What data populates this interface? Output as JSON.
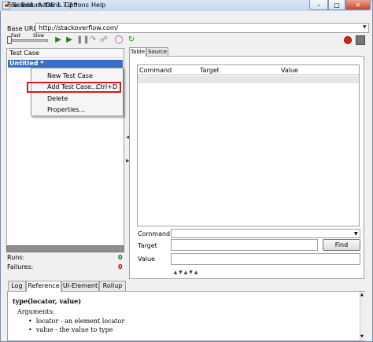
{
  "window": {
    "title": "Selenium IDE 1.7.2 *"
  },
  "menu": [
    "File",
    "Edit",
    "Actions",
    "Options",
    "Help"
  ],
  "base_url": {
    "label": "Base URL",
    "value": "http://stackoverflow.com/"
  },
  "toolbar": {
    "fast_label": "Fast",
    "slow_label": "Slow",
    "speed_level": 0.0
  },
  "test_case_panel": {
    "header": "Test Case",
    "selected_case": "Untitled *"
  },
  "context_menu": {
    "items": [
      "New Test Case",
      "Add Test Case...",
      "Ctrl+D",
      "Delete",
      "Properties..."
    ]
  },
  "editor_tabs": [
    "Table",
    "Source"
  ],
  "table": {
    "columns": [
      "Command",
      "Target",
      "Value"
    ]
  },
  "command_form": {
    "command_label": "Command",
    "target_label": "Target",
    "find_label": "Find",
    "value_label": "Value"
  },
  "stats": {
    "runs_label": "Runs:",
    "runs_value": "0",
    "failures_label": "Failures:",
    "failures_value": "0"
  },
  "bottom_tabs": [
    "Log",
    "Reference",
    "UI-Element",
    "Rollup"
  ],
  "reference": {
    "signature": "type(locator, value)",
    "arguments_label": "Arguments:",
    "args": [
      "locator - an element locator",
      "value - the value to type"
    ]
  },
  "colors": {
    "selection": "#3a6fc6",
    "highlight_border": "#d21e1e",
    "runs_ok": "#008800",
    "failures": "#cc0000"
  }
}
